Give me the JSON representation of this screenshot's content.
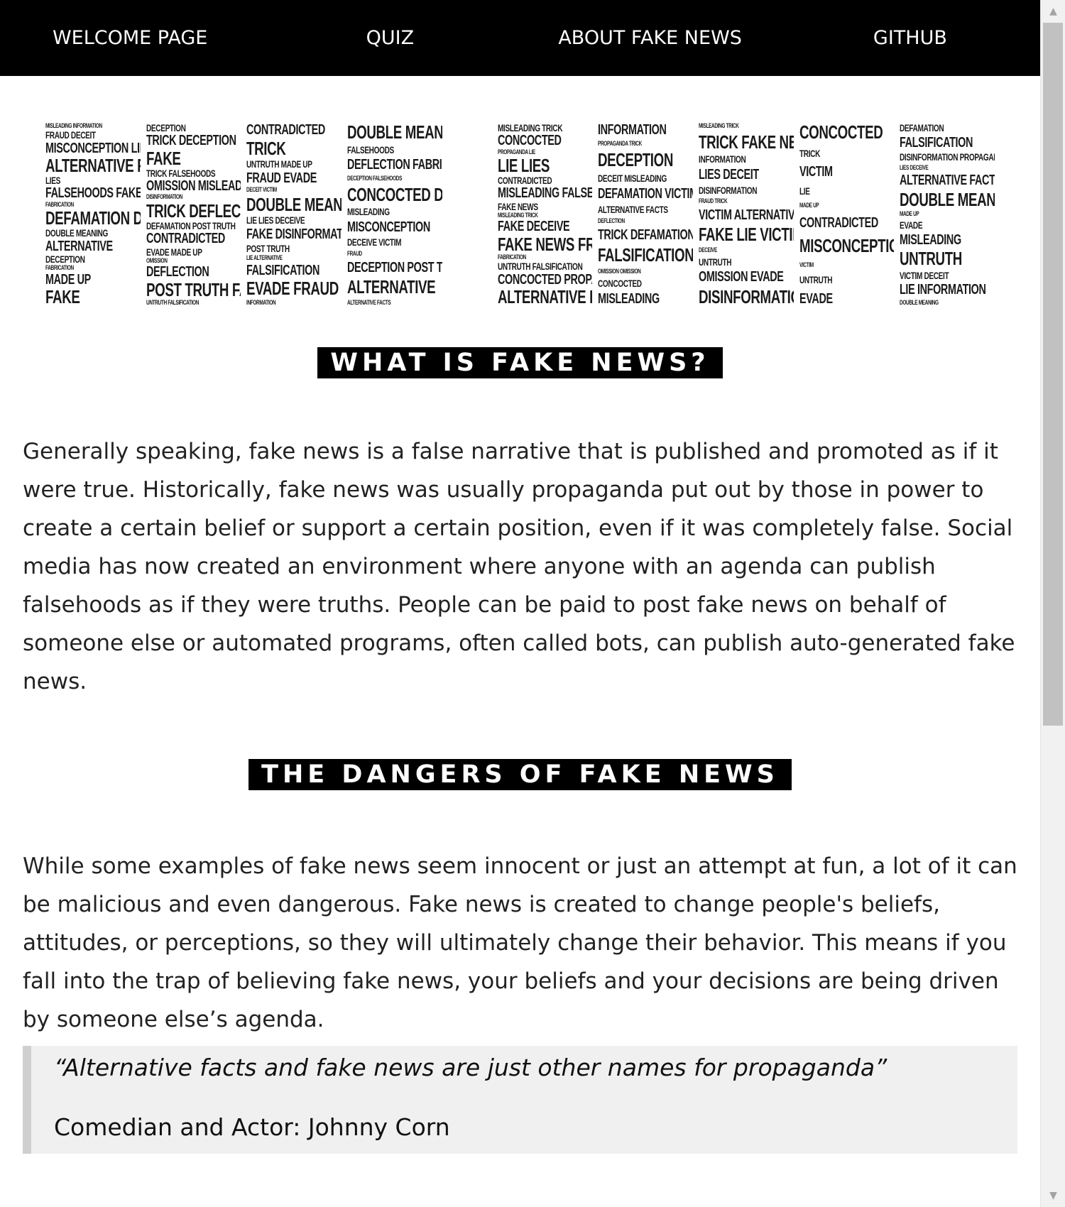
{
  "nav": {
    "items": [
      {
        "label": "WELCOME PAGE"
      },
      {
        "label": "QUIZ"
      },
      {
        "label": "ABOUT FAKE NEWS"
      },
      {
        "label": "GITHUB"
      }
    ]
  },
  "banner": {
    "letters": [
      {
        "words": [
          "Misleading Information",
          "Fraud Deceit",
          "Misconception Lies",
          "Alternative Facts",
          "Lies",
          "Falsehoods Fake News",
          "Fabrication",
          "Defamation Deceit",
          "Double Meaning",
          "Alternative",
          "Deception",
          "Fabrication",
          "Made Up",
          "Fake"
        ]
      },
      {
        "words": [
          "Deception",
          "Trick Deception",
          "Fake",
          "Trick Falsehoods",
          "Omission Misleading",
          "Disinformation",
          "Trick Deflection",
          "Defamation Post Truth",
          "Contradicted",
          "Evade Made Up",
          "Omission",
          "Deflection",
          "Post Truth Fake News",
          "Untruth Falsification"
        ]
      },
      {
        "words": [
          "Contradicted",
          "Trick",
          "Untruth Made Up",
          "Fraud Evade",
          "Deceit Victim",
          "Double Meaning",
          "Lie Lies Deceive",
          "Fake Disinformation",
          "Post Truth",
          "Lie Alternative",
          "Falsification",
          "Evade Fraud",
          "Information"
        ]
      },
      {
        "words": [
          "Double Meaning",
          "Falsehoods",
          "Deflection Fabrication",
          "Deception Falsehoods",
          "Concocted Deflection",
          "Misleading",
          "Misconception",
          "Deceive Victim",
          "Fraud",
          "Deception Post Truth",
          "Alternative",
          "Alternative Facts"
        ]
      },
      {
        "words": [
          "Misleading Trick",
          "Concocted",
          "Propaganda Lie",
          "Lie Lies",
          "Contradicted",
          "Misleading Falsehoods",
          "Fake News",
          "Misleading Trick",
          "Fake Deceive",
          "Fake News Fraud",
          "Fabrication",
          "Untruth Falsification",
          "Concocted Propaganda",
          "Alternative Information"
        ]
      },
      {
        "words": [
          "Information",
          "Propaganda Trick",
          "Deception",
          "Deceit Misleading",
          "Defamation Victim",
          "Alternative Facts",
          "Deflection",
          "Trick Defamation",
          "Falsification Fake",
          "Omission Omission",
          "Concocted",
          "Misleading"
        ]
      },
      {
        "words": [
          "Misleading Trick",
          "Trick Fake News",
          "Information",
          "Lies Deceit",
          "Disinformation",
          "Fraud Trick",
          "Victim Alternative Facts",
          "Fake Lie Victim",
          "Deceive",
          "Untruth",
          "Omission Evade",
          "Disinformation"
        ]
      },
      {
        "words": [
          "Concocted",
          "Trick",
          "Victim",
          "Lie",
          "Made Up",
          "Contradicted",
          "Misconception",
          "Victim",
          "Untruth",
          "Evade"
        ]
      },
      {
        "words": [
          "Defamation",
          "Falsification",
          "Disinformation Propaganda",
          "Lies Deceive",
          "Alternative Facts",
          "Double Meaning",
          "Made Up",
          "Evade",
          "Misleading",
          "Untruth",
          "Victim Deceit",
          "Lie Information",
          "Double Meaning"
        ]
      }
    ]
  },
  "section1": {
    "heading": "WHAT IS FAKE NEWS?",
    "paragraph": "Generally speaking, fake news is a false narrative that is published and promoted as if it were true. Historically, fake news was usually propaganda put out by those in power to create a certain belief or support a certain position, even if it was completely false. Social media has now created an environment where anyone with an agenda can publish falsehoods as if they were truths. People can be paid to post fake news on behalf of someone else or automated programs, often called bots, can publish auto-generated fake news."
  },
  "section2": {
    "heading": "THE DANGERS OF FAKE NEWS",
    "paragraph": "While some examples of fake news seem innocent or just an attempt at fun, a lot of it can be malicious and even dangerous. Fake news is created to change people's beliefs, attitudes, or perceptions, so they will ultimately change their behavior. This means if you fall into the trap of believing fake news, your beliefs and your decisions are being driven by someone else’s agenda."
  },
  "quote": {
    "text": "“Alternative facts and fake news are just other names for propaganda”",
    "author": "Comedian and Actor: Johnny Corn"
  },
  "scrollbar": {
    "up_icon": "▲",
    "down_icon": "▼",
    "position": 0
  }
}
